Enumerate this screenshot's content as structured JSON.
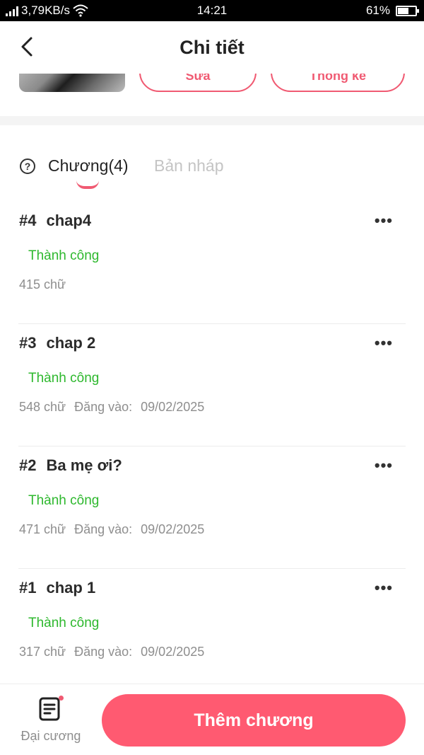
{
  "status_bar": {
    "network_speed": "3,79KB/s",
    "time": "14:21",
    "battery_percent": "61%",
    "battery_level": 0.61
  },
  "header": {
    "title": "Chi tiết",
    "back_icon": "chevron-left-icon"
  },
  "top_card": {
    "edit_label": "Sửa",
    "stats_label": "Thống kê"
  },
  "tabs": {
    "help_icon": "question-circle-icon",
    "chapters_label": "Chương(4)",
    "drafts_label": "Bản nháp"
  },
  "chapters": [
    {
      "num": "#4",
      "title": "chap4",
      "status": "Thành công",
      "words": "415 chữ",
      "published_label": "",
      "date": ""
    },
    {
      "num": "#3",
      "title": "chap 2",
      "status": "Thành công",
      "words": "548 chữ",
      "published_label": "Đăng vào:",
      "date": "09/02/2025"
    },
    {
      "num": "#2",
      "title": "Ba mẹ ơi?",
      "status": "Thành công",
      "words": "471 chữ",
      "published_label": "Đăng vào:",
      "date": "09/02/2025"
    },
    {
      "num": "#1",
      "title": "chap 1",
      "status": "Thành công",
      "words": "317 chữ",
      "published_label": "Đăng vào:",
      "date": "09/02/2025"
    }
  ],
  "more_icon_text": "•••",
  "bottom_bar": {
    "outline_label": "Đại cương",
    "outline_icon": "document-list-icon",
    "add_chapter_label": "Thêm chương"
  },
  "colors": {
    "accent": "#ff5a71",
    "success": "#2eb82e",
    "muted": "#8e8e8e"
  }
}
